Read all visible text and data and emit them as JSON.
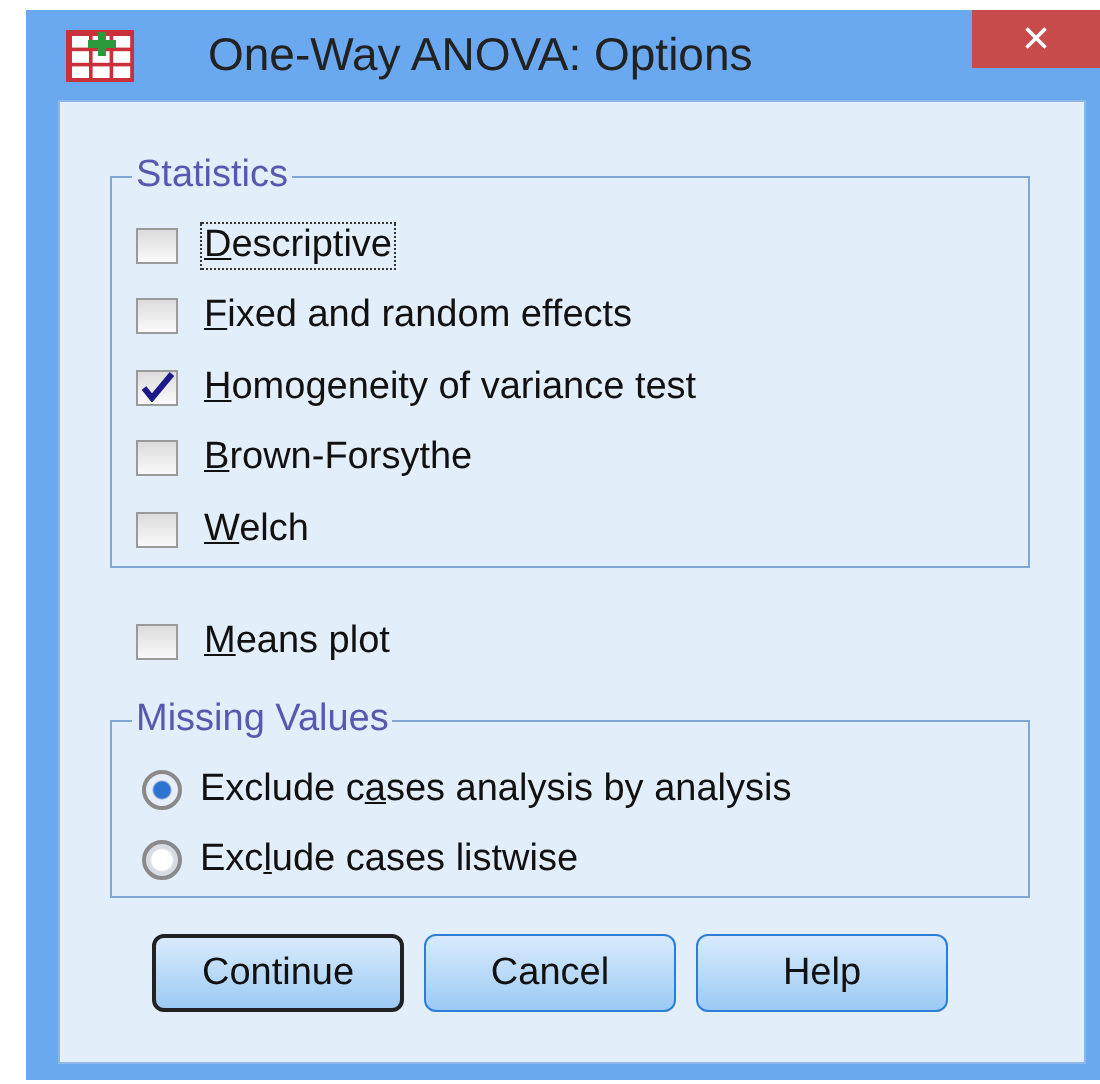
{
  "window": {
    "title": "One-Way ANOVA: Options",
    "close": "×"
  },
  "statistics": {
    "legend": "Statistics",
    "items": [
      {
        "key": "D",
        "after": "escriptive",
        "checked": false,
        "focused": true
      },
      {
        "key": "F",
        "after": "ixed and random effects",
        "checked": false,
        "focused": false
      },
      {
        "key": "H",
        "after": "omogeneity of variance test",
        "checked": true,
        "focused": false
      },
      {
        "key": "B",
        "after": "rown-Forsythe",
        "checked": false,
        "focused": false
      },
      {
        "key": "W",
        "after": "elch",
        "checked": false,
        "focused": false
      }
    ]
  },
  "means_plot": {
    "key": "M",
    "after": "eans plot",
    "checked": false
  },
  "missing_values": {
    "legend": "Missing Values",
    "options": [
      {
        "before": "Exclude c",
        "key": "a",
        "after": "ses analysis by analysis",
        "selected": true
      },
      {
        "before": "Exc",
        "key": "l",
        "after": "ude cases listwise",
        "selected": false
      }
    ]
  },
  "buttons": [
    {
      "label": "Continue",
      "default": true
    },
    {
      "label": "Cancel",
      "default": false
    },
    {
      "label": "Help",
      "default": false
    }
  ]
}
